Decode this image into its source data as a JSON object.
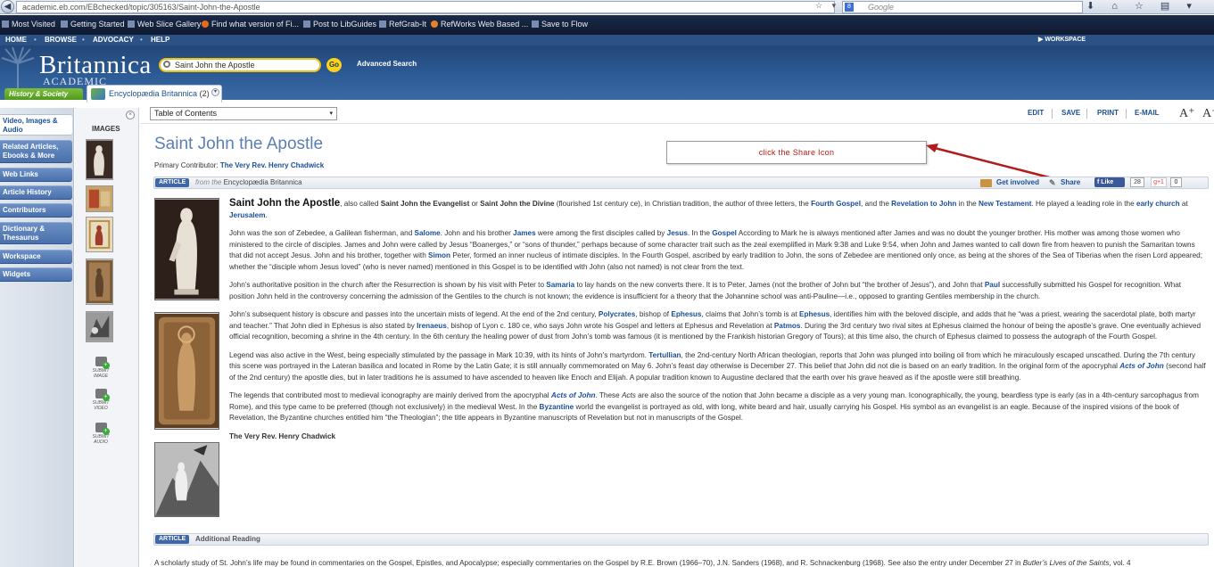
{
  "browser": {
    "back_glyph": "◀",
    "url": "academic.eb.com/EBchecked/topic/305163/Saint-John-the-Apostle",
    "url_actions": "☆ ▾ C",
    "search_engine": "Google",
    "engine_icon": "8",
    "tools": "⬇ ⌂ ☆ ▤ ▾"
  },
  "bookmarks": [
    "Most Visited",
    "Getting Started",
    "Web Slice Gallery",
    "Find what version of Fi...",
    "Post to LibGuides",
    "RefGrab-It",
    "RefWorks Web Based ...",
    "Save to Flow"
  ],
  "site": {
    "nav": [
      "HOME",
      "BROWSE",
      "ADVOCACY",
      "HELP"
    ],
    "nav_sep": "•",
    "workspace": "▶ WORKSPACE",
    "logo": "Britannica",
    "logo_sub": "ACADEMIC",
    "search_value": "Saint John the Apostle",
    "go": "Go",
    "advanced_search": "Advanced Search"
  },
  "subtabs": {
    "history": "History & Society",
    "eb": "Encyclopædia Britannica",
    "eb_count": "(2)",
    "eb_chevron": "▾"
  },
  "leftnav": [
    "Video, Images & Audio",
    "Related Articles, Ebooks & More",
    "Web Links",
    "Article History",
    "Contributors",
    "Dictionary & Thesaurus",
    "Workspace",
    "Widgets"
  ],
  "images_panel": {
    "heading": "IMAGES",
    "close": "×",
    "submit": [
      "SUBMIT IMAGE",
      "SUBMIT VIDEO",
      "SUBMIT AUDIO"
    ]
  },
  "toc": {
    "label": "Table of Contents",
    "arrow": "▾"
  },
  "toolbar": [
    "EDIT",
    "SAVE",
    "PRINT",
    "E-MAIL"
  ],
  "font_controls": {
    "up": "A⁺",
    "down": "A⁻"
  },
  "article": {
    "title": "Saint John the Apostle",
    "contrib_label": "Primary Contributor:",
    "contributor": "The Very Rev. Henry Chadwick",
    "badge": "ARTICLE",
    "from_label": "from the",
    "source": "Encyclopædia Britannica",
    "get_involved": "Get involved",
    "share": "Share",
    "share_glyph": "✎",
    "fb_like": "f Like",
    "fb_count": "28",
    "gplus": "g+1",
    "gplus_count": "0"
  },
  "callout": "click the Share Icon",
  "body": {
    "p1": {
      "title": "Saint John the Apostle",
      "t1": ", also called ",
      "alt1": "Saint John the Evangelist",
      "t2": " or ",
      "alt2": "Saint John the Divine",
      "t3": " (flourished 1st century ce), in Christian tradition, the author of three letters, the ",
      "l1": "Fourth Gospel",
      "t4": ", and the ",
      "l2": "Revelation to John",
      "t5": " in the ",
      "l3": "New Testament",
      "t6": ". He played a leading role in the ",
      "l4": "early church",
      "t7": " at ",
      "l5": "Jerusalem",
      "t8": "."
    },
    "p2": {
      "t1": "John was the son of Zebedee, a Galilean fisherman, and ",
      "l1": "Salome",
      "t2": ". John and his brother ",
      "l2": "James",
      "t3": " were among the first disciples called by ",
      "l3": "Jesus",
      "t4": ". In the ",
      "l4": "Gospel",
      "t5": " According to Mark he is always mentioned after James and was no doubt the younger brother. His mother was among those women who ministered to the circle of disciples. James and John were called by Jesus “Boanerges,” or “sons of thunder,” perhaps because of some character trait such as the zeal exemplified in Mark 9:38 and Luke 9:54, when John and James wanted to call down fire from heaven to punish the Samaritan towns that did not accept Jesus. John and his brother, together with ",
      "l5": "Simon",
      "t6": " Peter, formed an inner nucleus of intimate disciples. In the Fourth Gospel, ascribed by early tradition to John, the sons of Zebedee are mentioned only once, as being at the shores of the Sea of Tiberias when the risen Lord appeared; whether the “disciple whom Jesus loved” (who is never named) mentioned in this Gospel is to be identified with John (also not named) is not clear from the text."
    },
    "p3": {
      "t1": "John’s authoritative position in the church after the Resurrection is shown by his visit with Peter to ",
      "l1": "Samaria",
      "t2": " to lay hands on the new converts there. It is to Peter, James (not the brother of John but “the brother of Jesus”), and John that ",
      "l2": "Paul",
      "t3": " successfully submitted his Gospel for recognition. What position John held in the controversy concerning the admission of the Gentiles to the church is not known; the evidence is insufficient for a theory that the Johannine school was anti-Pauline—i.e., opposed to granting Gentiles membership in the church."
    },
    "p4": {
      "t1": "John’s subsequent history is obscure and passes into the uncertain mists of legend. At the end of the 2nd century, ",
      "l1": "Polycrates",
      "t2": ", bishop of ",
      "l2": "Ephesus",
      "t3": ", claims that John’s tomb is at ",
      "l3": "Ephesus",
      "t4": ", identifies him with the beloved disciple, and adds that he “was a priest, wearing the sacerdotal plate, both martyr and teacher.” That John died in Ephesus is also stated by ",
      "l4": "Irenaeus",
      "t5": ", bishop of Lyon c. 180 ce, who says John wrote his Gospel and letters at Ephesus and Revelation at ",
      "l5": "Patmos",
      "t6": ". During the 3rd century two rival sites at Ephesus claimed the honour of being the apostle’s grave. One eventually achieved official recognition, becoming a shrine in the 4th century. In the 6th century the healing power of dust from John’s tomb was famous (it is mentioned by the Frankish historian Gregory of Tours); at this time also, the church of Ephesus claimed to possess the autograph of the Fourth Gospel."
    },
    "p5": {
      "t1": "Legend was also active in the West, being especially stimulated by the passage in Mark 10:39, with its hints of John’s martyrdom. ",
      "l1": "Tertullian",
      "t2": ", the 2nd-century North African theologian, reports that John was plunged into boiling oil from which he miraculously escaped unscathed. During the 7th century this scene was portrayed in the Lateran basilica and located in Rome by the Latin Gate; it is still annually commemorated on May 6. John’s feast day otherwise is December 27. This belief that John did not die is based on an early tradition. In the original form of the apocryphal ",
      "l2": "Acts of John",
      "t3": " (second half of the 2nd century) the apostle dies, but in later traditions he is assumed to have ascended to heaven like Enoch and Elijah. A popular tradition known to Augustine declared that the earth over his grave heaved as if the apostle were still breathing."
    },
    "p6": {
      "t1": "The legends that contributed most to medieval iconography are mainly derived from the apocryphal ",
      "l1": "Acts of John",
      "t2": ". These ",
      "i1": "Acts",
      "t3": " are also the source of the notion that John became a disciple as a very young man. Iconographically, the young, beardless type is early (as in a 4th-century sarcophagus from Rome), and this type came to be preferred (though not exclusively) in the medieval West. In the ",
      "l2": "Byzantine",
      "t4": " world the evangelist is portrayed as old, with long, white beard and hair, usually carrying his Gospel. His symbol as an evangelist is an eagle. Because of the inspired visions of the book of Revelation, the Byzantine churches entitled him “the Theologian”; the title appears in Byzantine manuscripts of Revelation but not in manuscripts of the Gospel."
    },
    "signature": "The Very Rev. Henry Chadwick"
  },
  "additional_reading": {
    "badge": "ARTICLE",
    "title": "Additional Reading",
    "t1": "A scholarly study of St. John’s life may be found in commentaries on the Gospel, Epistles, and Apocalypse; especially commentaries on the Gospel by R.E. Brown (1966–70), J.N. Sanders (1968), and R. Schnackenburg (1968). See also the entry under December 27 in ",
    "i1": "Butler’s Lives of the Saints",
    "t2": ", vol. 4"
  }
}
